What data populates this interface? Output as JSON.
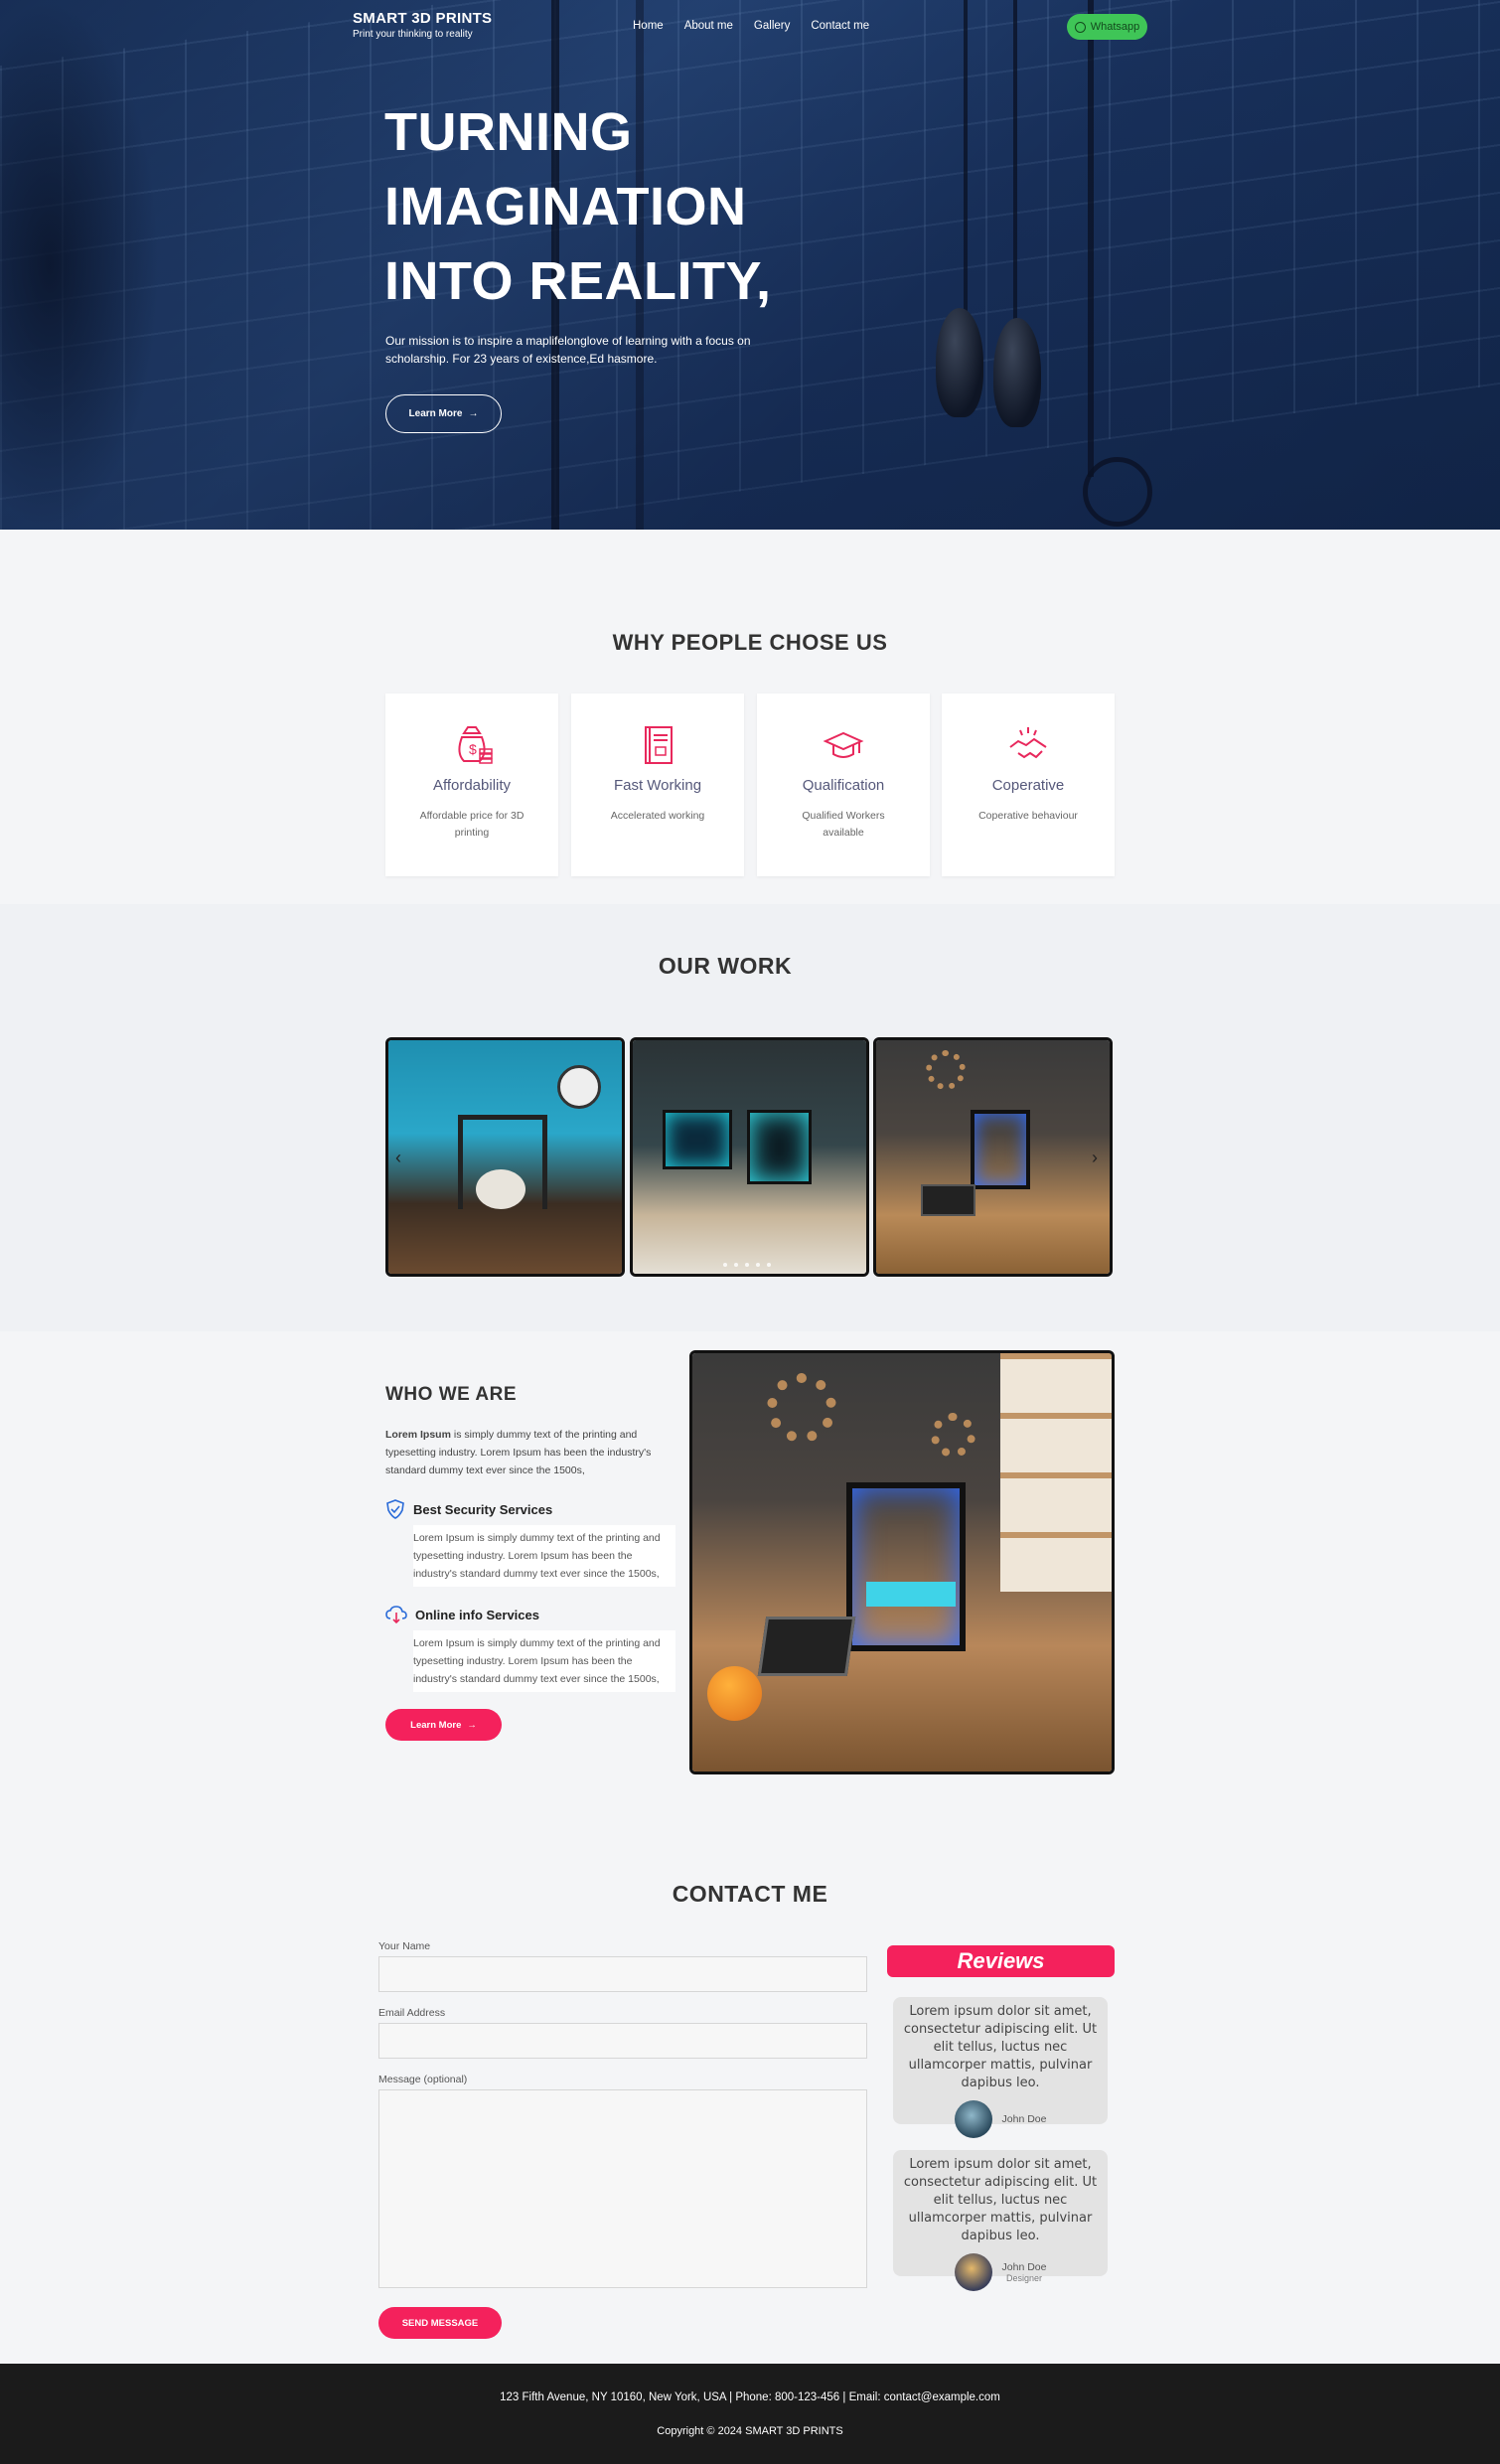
{
  "header": {
    "brand_name": "SMART 3D PRINTS",
    "brand_tagline": "Print your thinking to reality",
    "nav": [
      "Home",
      "About me",
      "Gallery",
      "Contact me"
    ],
    "whatsapp_label": "Whatsapp",
    "whatsapp_color": "#3fc557"
  },
  "hero": {
    "title_lines": [
      "TURNING",
      "IMAGINATION",
      "INTO REALITY,"
    ],
    "text": "Our mission is to inspire a maplifelonglove of learning with a focus on scholarship. For 23 years of existence,Ed hasmore.",
    "button_label": "Learn More"
  },
  "why": {
    "title": "WHY PEOPLE CHOSE US",
    "features": [
      {
        "icon": "money-bag-icon",
        "title": "Affordability",
        "desc": "Affordable price for 3D printing"
      },
      {
        "icon": "book-icon",
        "title": "Fast Working",
        "desc": "Accelerated working"
      },
      {
        "icon": "graduation-cap-icon",
        "title": "Qualification",
        "desc": "Qualified Workers available"
      },
      {
        "icon": "handshake-icon",
        "title": "Coperative",
        "desc": "Coperative behaviour"
      }
    ]
  },
  "work": {
    "title": "OUR WORK",
    "prev_icon": "chevron-left-icon",
    "next_icon": "chevron-right-icon"
  },
  "who": {
    "title": "WHO WE ARE",
    "intro_bold": "Lorem Ipsum",
    "intro_rest": " is simply dummy text of the printing and typesetting industry. Lorem Ipsum has been the industry's standard dummy text ever since the 1500s,",
    "services": [
      {
        "icon": "shield-icon",
        "title": "Best Security Services",
        "text": "Lorem Ipsum is simply dummy text of the printing and typesetting industry. Lorem Ipsum has been the industry's standard dummy text ever since the 1500s,"
      },
      {
        "icon": "cloud-download-icon",
        "title": "Online info Services",
        "text": "Lorem Ipsum is simply dummy text of the printing and typesetting industry. Lorem Ipsum has been the industry's standard dummy text ever since the 1500s,"
      }
    ],
    "button_label": "Learn More"
  },
  "contact": {
    "title": "CONTACT ME",
    "name_label": "Your Name",
    "email_label": "Email Address",
    "message_label": "Message (optional)",
    "send_label": "SEND MESSAGE",
    "accent": "#f4215c"
  },
  "reviews": {
    "title": "Reviews",
    "items": [
      {
        "text": "Lorem ipsum dolor sit amet, consectetur adipiscing elit. Ut elit tellus, luctus nec ullamcorper mattis, pulvinar dapibus leo.",
        "name": "John Doe",
        "role": ""
      },
      {
        "text": "Lorem ipsum dolor sit amet, consectetur adipiscing elit. Ut elit tellus, luctus nec ullamcorper mattis, pulvinar dapibus leo.",
        "name": "John Doe",
        "role": "Designer"
      }
    ]
  },
  "footer": {
    "address": "123 Fifth Avenue, NY 10160, New York, USA | Phone: 800-123-456 | Email: contact@example.com",
    "copyright": "Copyright © 2024 SMART 3D PRINTS"
  }
}
